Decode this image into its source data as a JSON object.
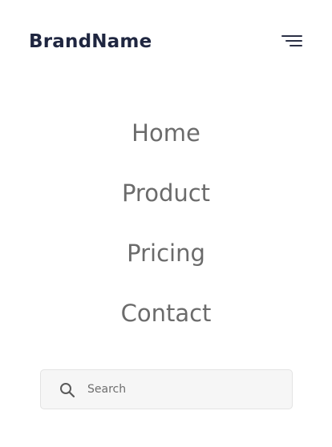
{
  "header": {
    "brand": "BrandName",
    "menu_icon": "hamburger-menu-icon"
  },
  "nav": {
    "items": [
      {
        "label": "Home"
      },
      {
        "label": "Product"
      },
      {
        "label": "Pricing"
      },
      {
        "label": "Contact"
      }
    ]
  },
  "search": {
    "placeholder": "Search",
    "value": "",
    "icon": "search-icon"
  },
  "colors": {
    "brand_text": "#1f2640",
    "nav_text": "#6b6b6b",
    "search_bg": "#f6f6f6",
    "search_border": "#e3e3e3"
  }
}
